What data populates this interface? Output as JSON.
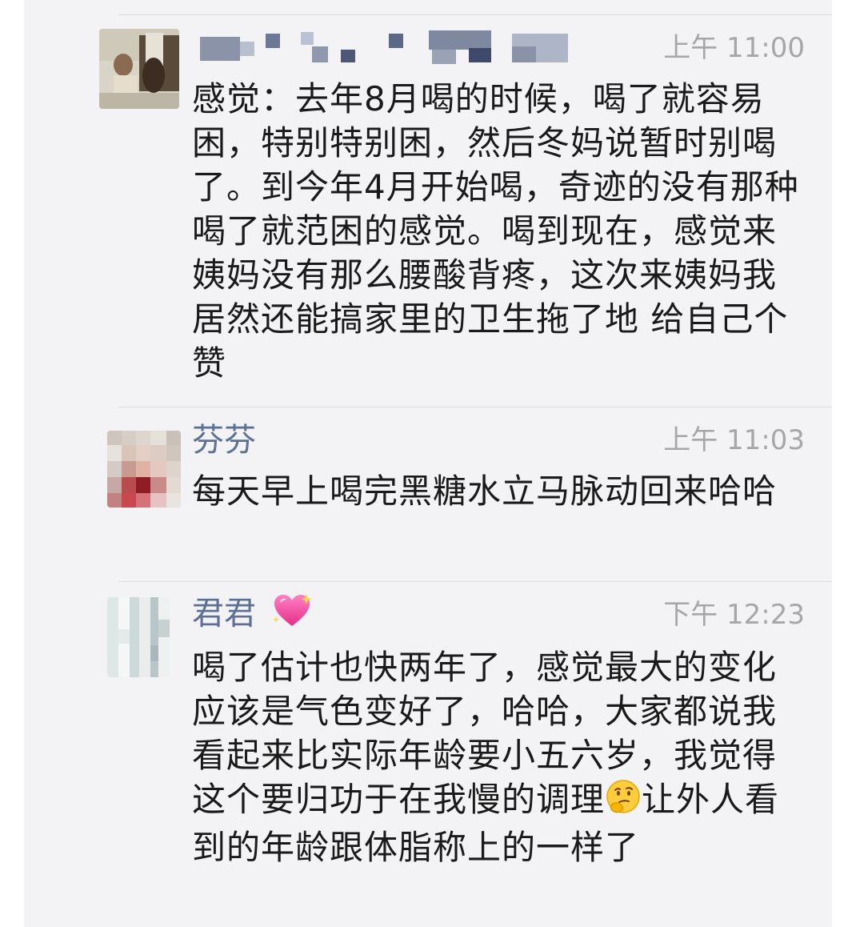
{
  "messages": [
    {
      "name": "",
      "time": "上午 11:00",
      "text": "感觉：去年8月喝的时候，喝了就容易困，特别特别困，然后冬妈说暂时别喝了。到今年4月开始喝，奇迹的没有那种喝了就范困的感觉。喝到现在，感觉来姨妈没有那么腰酸背疼，这次来姨妈我居然还能搞家里的卫生拖了地 给自己个赞"
    },
    {
      "name": "芬芬",
      "time": "上午 11:03",
      "text": "每天早上喝完黑糖水立马脉动回来哈哈"
    },
    {
      "name": "君君",
      "name_emoji": "sparkling-heart-icon",
      "time": "下午 12:23",
      "text_before_emoji": "喝了估计也快两年了，感觉最大的变化应该是气色变好了，哈哈，大家都说我看起来比实际年龄要小五六岁，我觉得这个要归功于在我慢的调理",
      "inline_emoji": "thinking-face-icon",
      "text_after_emoji": "让外人看到的年龄跟体脂称上的一样了"
    }
  ],
  "colors": {
    "panel_bg": "#f3f3f5",
    "name": "#5c6f95",
    "time": "#a6a6a6",
    "text": "#1a1a1a",
    "divider": "#dcdcde"
  }
}
